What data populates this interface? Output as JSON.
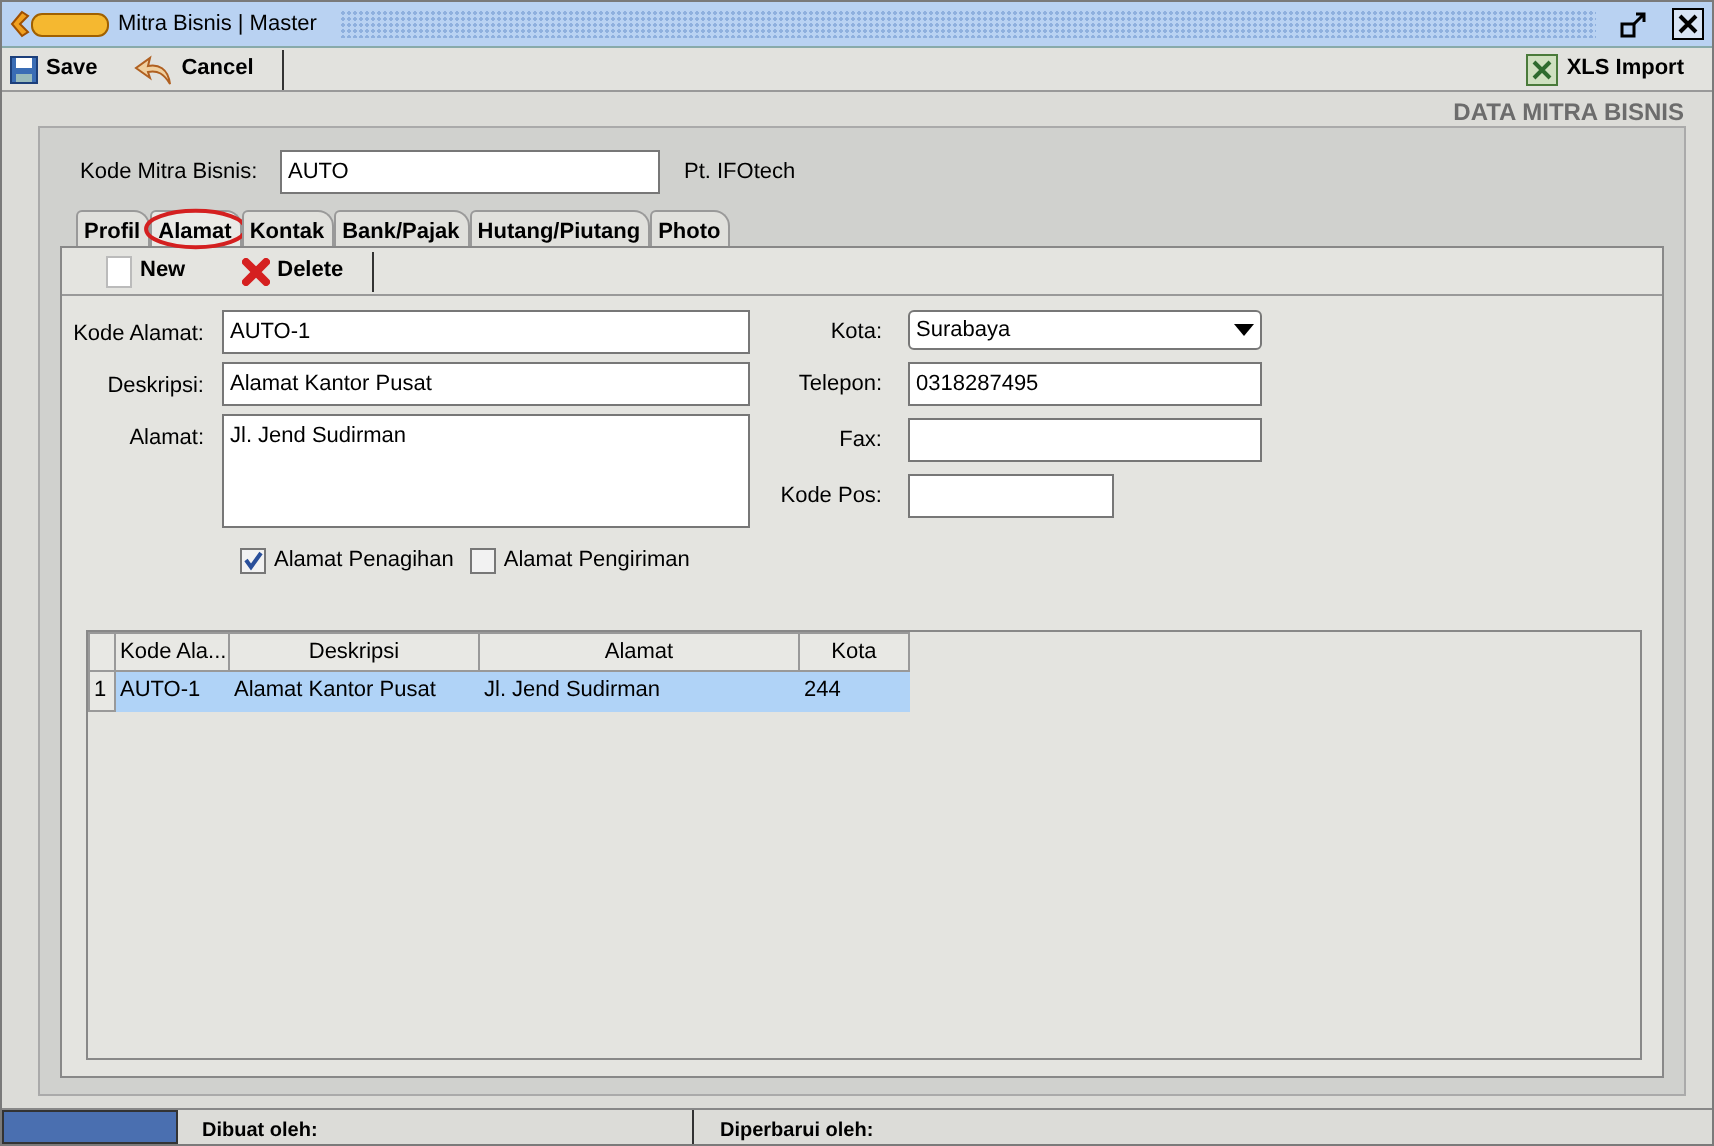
{
  "window": {
    "title": "Mitra Bisnis | Master"
  },
  "toolbar": [
    {
      "label": "Save",
      "kind": "save"
    },
    {
      "label": "Cancel",
      "kind": "cancel"
    },
    {
      "label": "XLS Import",
      "kind": "xls"
    }
  ],
  "header_title": "DATA MITRA BISNIS",
  "kode_mitra": {
    "label": "Kode Mitra Bisnis:",
    "value": "AUTO",
    "company": "Pt. IFOtech"
  },
  "tabs": [
    {
      "label": "Profil",
      "selected": false,
      "circled": false
    },
    {
      "label": "Alamat",
      "selected": true,
      "circled": true
    },
    {
      "label": "Kontak",
      "selected": false,
      "circled": false
    },
    {
      "label": "Bank/Pajak",
      "selected": false,
      "circled": false
    },
    {
      "label": "Hutang/Piutang",
      "selected": false,
      "circled": false
    },
    {
      "label": "Photo",
      "selected": false,
      "circled": false
    }
  ],
  "sub_toolbar": [
    {
      "label": "New",
      "kind": "new"
    },
    {
      "label": "Delete",
      "kind": "delete"
    }
  ],
  "left_fields": [
    {
      "label": "Kode Alamat:",
      "value": "AUTO-1",
      "kind": "text"
    },
    {
      "label": "Deskripsi:",
      "value": "Alamat Kantor Pusat",
      "kind": "text"
    },
    {
      "label": "Alamat:",
      "value": "Jl. Jend Sudirman",
      "kind": "area"
    }
  ],
  "checkboxes": [
    {
      "label": "Alamat Penagihan",
      "checked": true
    },
    {
      "label": "Alamat Pengiriman",
      "checked": false
    }
  ],
  "right_fields": [
    {
      "label": "Kota:",
      "value": "Surabaya",
      "kind": "select"
    },
    {
      "label": "Telepon:",
      "value": "0318287495",
      "kind": "text"
    },
    {
      "label": "Fax:",
      "kind": "text"
    },
    {
      "label": "Kode Pos:",
      "kind": "short"
    }
  ],
  "table": {
    "columns": [
      "Kode Ala...",
      "Deskripsi",
      "Alamat",
      "Kota"
    ],
    "rows": [
      {
        "number": "1",
        "selected": true,
        "cells": [
          "AUTO-1",
          "Alamat Kantor Pusat",
          "Jl. Jend Sudirman",
          "244"
        ]
      }
    ]
  },
  "status_bar": [
    "Dibuat oleh:",
    "Diperbarui oleh:"
  ]
}
